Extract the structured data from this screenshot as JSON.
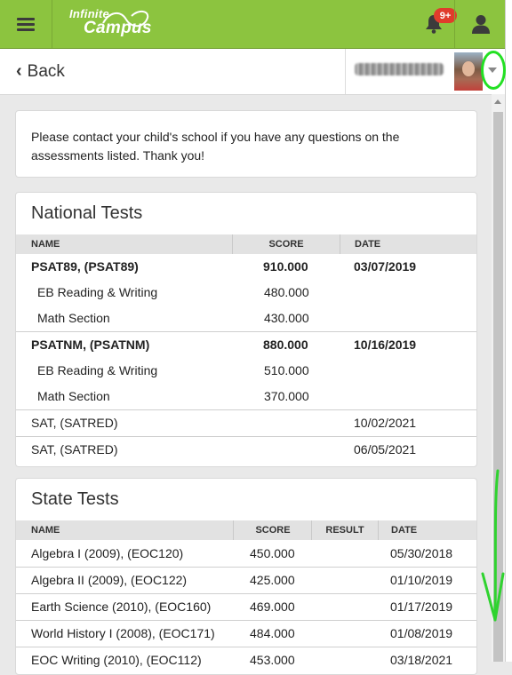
{
  "header": {
    "brand_top": "Infinite",
    "brand_bottom": "Campus",
    "notification_badge": "9+",
    "accent_color": "#8cc43f"
  },
  "subheader": {
    "back_label": "Back"
  },
  "notice": {
    "text": "Please contact your child's school if you have any questions on the assessments listed.  Thank you!"
  },
  "national": {
    "title": "National Tests",
    "columns": [
      "NAME",
      "SCORE",
      "DATE"
    ],
    "rows": [
      {
        "name": "PSAT89, (PSAT89)",
        "score": "910.000",
        "date": "03/07/2019"
      },
      {
        "name": "EB Reading & Writing",
        "score": "480.000",
        "date": ""
      },
      {
        "name": "Math Section",
        "score": "430.000",
        "date": ""
      },
      {
        "name": "PSATNM, (PSATNM)",
        "score": "880.000",
        "date": "10/16/2019"
      },
      {
        "name": "EB Reading & Writing",
        "score": "510.000",
        "date": ""
      },
      {
        "name": "Math Section",
        "score": "370.000",
        "date": ""
      },
      {
        "name": "SAT, (SATRED)",
        "score": "",
        "date": "10/02/2021"
      },
      {
        "name": "SAT, (SATRED)",
        "score": "",
        "date": "06/05/2021"
      }
    ]
  },
  "state": {
    "title": "State Tests",
    "columns": [
      "NAME",
      "SCORE",
      "RESULT",
      "DATE"
    ],
    "rows": [
      {
        "name": "Algebra I (2009), (EOC120)",
        "score": "450.000",
        "result": "",
        "date": "05/30/2018"
      },
      {
        "name": "Algebra II (2009), (EOC122)",
        "score": "425.000",
        "result": "",
        "date": "01/10/2019"
      },
      {
        "name": "Earth Science (2010), (EOC160)",
        "score": "469.000",
        "result": "",
        "date": "01/17/2019"
      },
      {
        "name": "World History I (2008), (EOC171)",
        "score": "484.000",
        "result": "",
        "date": "01/08/2019"
      },
      {
        "name": "EOC Writing (2010), (EOC112)",
        "score": "453.000",
        "result": "",
        "date": "03/18/2021"
      }
    ]
  }
}
